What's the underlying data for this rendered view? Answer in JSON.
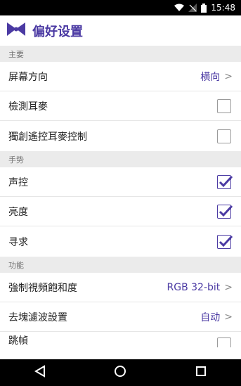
{
  "status_bar": {
    "time": "15:48"
  },
  "app_bar": {
    "title": "偏好设置",
    "logo_icon": "bowtie-logo-icon"
  },
  "sections": {
    "main": {
      "header": "主要"
    },
    "gesture": {
      "header": "手势"
    },
    "function": {
      "header": "功能"
    }
  },
  "rows": {
    "orientation": {
      "label": "屏幕方向",
      "value": "横向"
    },
    "detect_headset": {
      "label": "檢測耳麥",
      "checked": false
    },
    "exclusive_headset": {
      "label": "獨創遙控耳麥控制",
      "checked": false
    },
    "voice": {
      "label": "声控",
      "checked": true
    },
    "brightness": {
      "label": "亮度",
      "checked": true
    },
    "seek": {
      "label": "寻求",
      "checked": true
    },
    "force_saturation": {
      "label": "強制視頻飽和度",
      "value": "RGB 32-bit"
    },
    "deblocking": {
      "label": "去塊濾波設置",
      "value": "自动"
    },
    "frame_skip": {
      "label": "跳幀",
      "checked": false
    }
  },
  "colors": {
    "accent": "#4b3aa3",
    "section_bg": "#ebebeb"
  },
  "nav_bar": {
    "back_icon": "back-triangle-icon",
    "home_icon": "home-circle-icon",
    "recents_icon": "recents-square-icon"
  }
}
